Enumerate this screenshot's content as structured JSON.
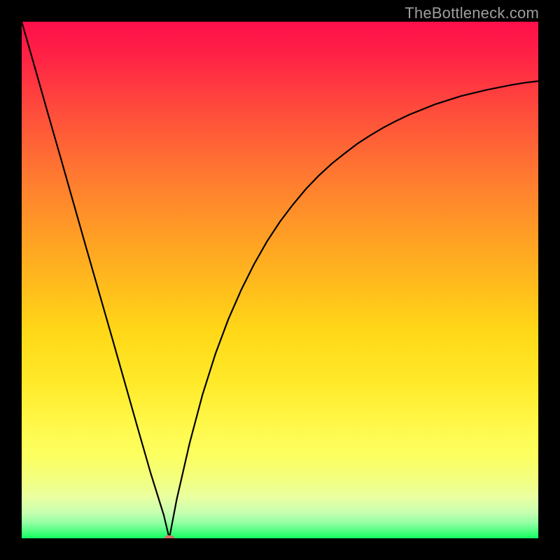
{
  "watermark": "TheBottleneck.com",
  "chart_data": {
    "type": "line",
    "title": "",
    "xlabel": "",
    "ylabel": "",
    "xlim": [
      0,
      100
    ],
    "ylim": [
      0,
      100
    ],
    "series": [
      {
        "name": "bottleneck-curve",
        "x": [
          0,
          2.5,
          5,
          7.5,
          10,
          12.5,
          15,
          17.5,
          20,
          22.5,
          25,
          27.5,
          28.57,
          30,
          32.5,
          35,
          37.5,
          40,
          42.5,
          45,
          47.5,
          50,
          52.5,
          55,
          57.5,
          60,
          62.5,
          65,
          67.5,
          70,
          72.5,
          75,
          77.5,
          80,
          82.5,
          85,
          87.5,
          90,
          92.5,
          95,
          97.5,
          100
        ],
        "y": [
          100,
          91.3,
          82.5,
          73.8,
          65,
          56.2,
          47.5,
          38.8,
          30,
          21.2,
          12.5,
          4.5,
          0,
          7.5,
          18.4,
          27.8,
          35.7,
          42.4,
          48.1,
          53.1,
          57.5,
          61.3,
          64.6,
          67.6,
          70.2,
          72.5,
          74.5,
          76.4,
          78.0,
          79.5,
          80.8,
          82.0,
          83.0,
          84.0,
          84.8,
          85.6,
          86.2,
          86.8,
          87.3,
          87.8,
          88.2,
          88.5
        ]
      }
    ],
    "minimum_point": {
      "x": 28.57,
      "y": 0
    },
    "legend": [],
    "grid": false
  },
  "colors": {
    "background": "#000000",
    "curve_stroke": "#000000",
    "marker_fill": "#d46f6a",
    "watermark_text": "#9e9e9e"
  }
}
